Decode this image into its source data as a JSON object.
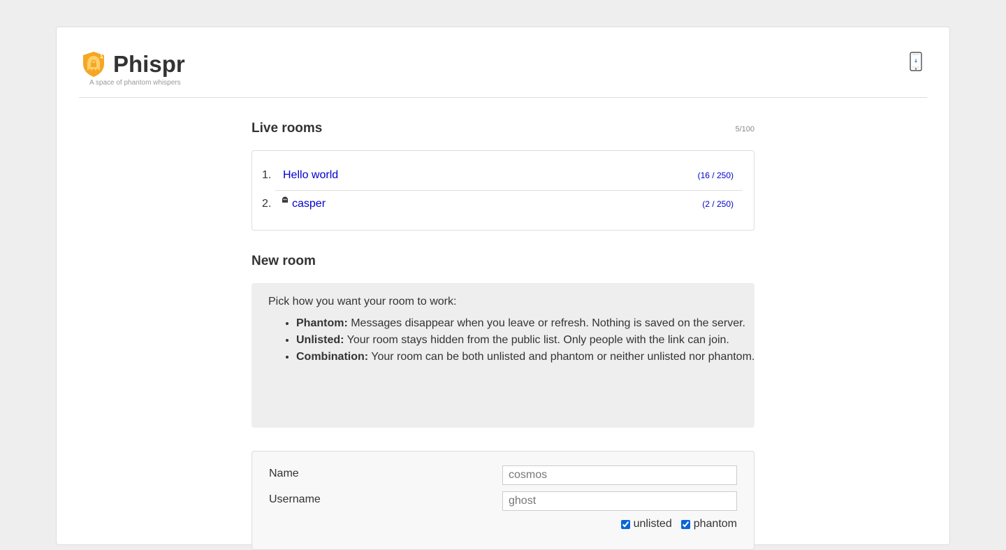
{
  "app": {
    "name": "Phispr",
    "tagline": "A space of phantom whispers",
    "brand_color": "#f5a623"
  },
  "live_rooms": {
    "title": "Live rooms",
    "count": "5/100",
    "rooms": [
      {
        "index": "1.",
        "name": "Hello world",
        "occupancy": "(16 / 250)",
        "phantom": false
      },
      {
        "index": "2.",
        "name": "casper",
        "occupancy": "(2 / 250)",
        "phantom": true
      }
    ]
  },
  "new_room": {
    "title": "New room",
    "intro": "Pick how you want your room to work:",
    "options": [
      {
        "term": "Phantom:",
        "desc": " Messages disappear when you leave or refresh. Nothing is saved on the server."
      },
      {
        "term": "Unlisted:",
        "desc": " Your room stays hidden from the public list. Only people with the link can join."
      },
      {
        "term": "Combination:",
        "desc": " Your room can be both unlisted and phantom or neither unlisted nor phantom."
      }
    ],
    "form": {
      "name_label": "Name",
      "name_placeholder": "cosmos",
      "username_label": "Username",
      "username_placeholder": "ghost",
      "unlisted_label": "unlisted",
      "phantom_label": "phantom",
      "unlisted_checked": true,
      "phantom_checked": true
    }
  },
  "colors": {
    "link": "#0000cc",
    "background": "#eeeeee",
    "accent_checkbox": "#0a66d8"
  },
  "icons": {
    "logo": "hooded-ghost-shield-icon",
    "device_toggle": "mobile-device-icon",
    "phantom_room": "ghost-icon"
  }
}
